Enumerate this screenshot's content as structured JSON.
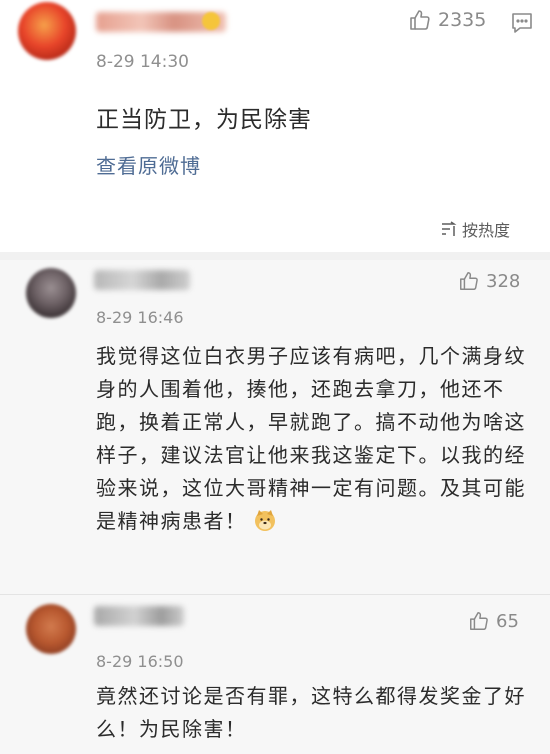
{
  "main_post": {
    "timestamp": "8-29 14:30",
    "text": "正当防卫，为民除害",
    "view_original": "查看原微博",
    "likes": "2335",
    "sort_label": "按热度"
  },
  "comments": [
    {
      "likes": "328",
      "timestamp": "8-29 16:46",
      "text": "我觉得这位白衣男子应该有病吧，几个满身纹身的人围着他，揍他，还跑去拿刀，他还不跑，换着正常人，早就跑了。搞不动他为啥这样子，建议法官让他来我这鉴定下。以我的经验来说，这位大哥精神一定有问题。及其可能是精神病患者！"
    },
    {
      "likes": "65",
      "timestamp": "8-29 16:50",
      "text": "竟然还讨论是否有罪，这特么都得发奖金了好么！为民除害！"
    }
  ],
  "icons": {
    "like": "thumbs-up-icon",
    "comment": "comment-icon",
    "sort": "sort-icon",
    "emoji": "doge-emoji-icon"
  },
  "colors": {
    "link": "#4f6c94",
    "muted": "#8f8f8f",
    "text": "#2b2b2b",
    "comment_bg": "#f7f7f7"
  }
}
